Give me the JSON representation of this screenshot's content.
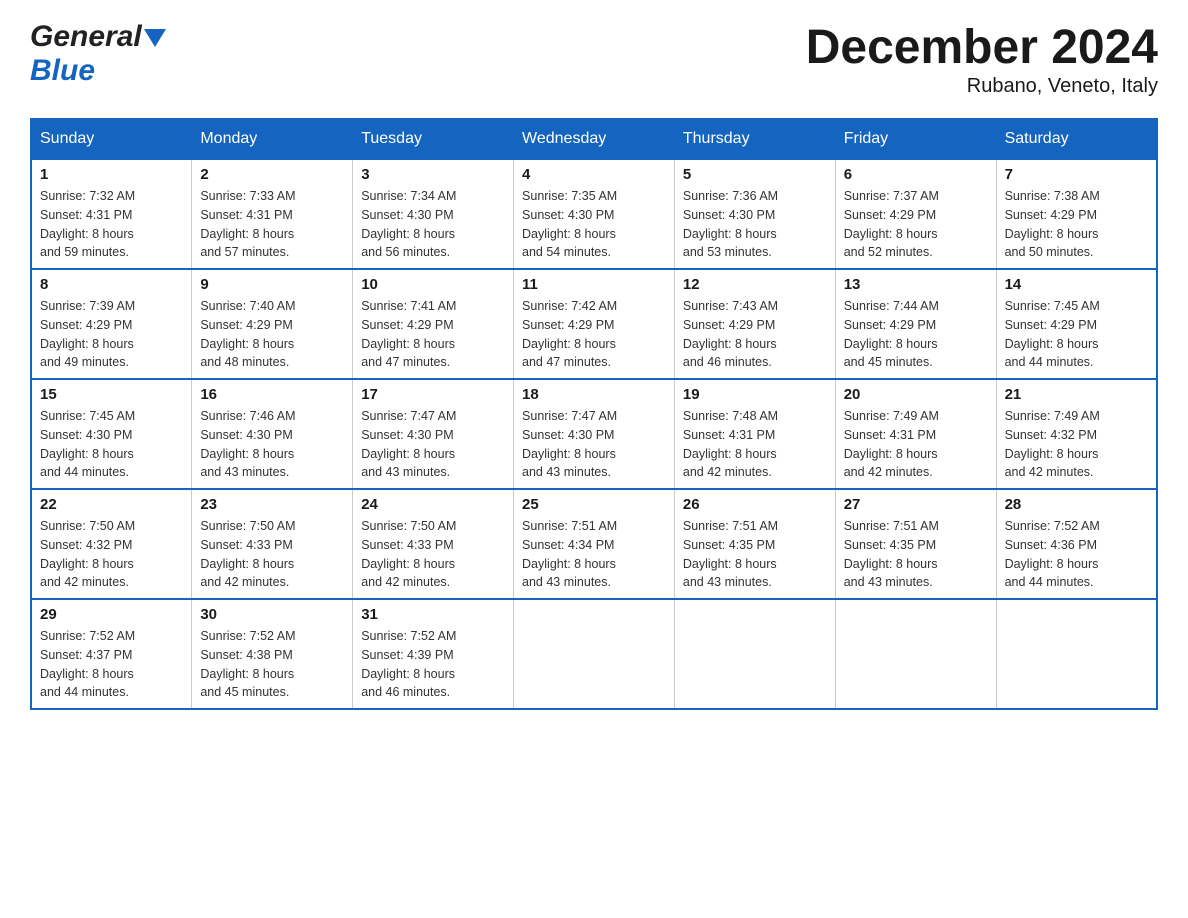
{
  "header": {
    "logo": {
      "general": "General",
      "blue": "Blue"
    },
    "title": "December 2024",
    "subtitle": "Rubano, Veneto, Italy"
  },
  "days_of_week": [
    "Sunday",
    "Monday",
    "Tuesday",
    "Wednesday",
    "Thursday",
    "Friday",
    "Saturday"
  ],
  "weeks": [
    [
      {
        "day": 1,
        "sunrise": "7:32 AM",
        "sunset": "4:31 PM",
        "daylight": "8 hours and 59 minutes."
      },
      {
        "day": 2,
        "sunrise": "7:33 AM",
        "sunset": "4:31 PM",
        "daylight": "8 hours and 57 minutes."
      },
      {
        "day": 3,
        "sunrise": "7:34 AM",
        "sunset": "4:30 PM",
        "daylight": "8 hours and 56 minutes."
      },
      {
        "day": 4,
        "sunrise": "7:35 AM",
        "sunset": "4:30 PM",
        "daylight": "8 hours and 54 minutes."
      },
      {
        "day": 5,
        "sunrise": "7:36 AM",
        "sunset": "4:30 PM",
        "daylight": "8 hours and 53 minutes."
      },
      {
        "day": 6,
        "sunrise": "7:37 AM",
        "sunset": "4:29 PM",
        "daylight": "8 hours and 52 minutes."
      },
      {
        "day": 7,
        "sunrise": "7:38 AM",
        "sunset": "4:29 PM",
        "daylight": "8 hours and 50 minutes."
      }
    ],
    [
      {
        "day": 8,
        "sunrise": "7:39 AM",
        "sunset": "4:29 PM",
        "daylight": "8 hours and 49 minutes."
      },
      {
        "day": 9,
        "sunrise": "7:40 AM",
        "sunset": "4:29 PM",
        "daylight": "8 hours and 48 minutes."
      },
      {
        "day": 10,
        "sunrise": "7:41 AM",
        "sunset": "4:29 PM",
        "daylight": "8 hours and 47 minutes."
      },
      {
        "day": 11,
        "sunrise": "7:42 AM",
        "sunset": "4:29 PM",
        "daylight": "8 hours and 47 minutes."
      },
      {
        "day": 12,
        "sunrise": "7:43 AM",
        "sunset": "4:29 PM",
        "daylight": "8 hours and 46 minutes."
      },
      {
        "day": 13,
        "sunrise": "7:44 AM",
        "sunset": "4:29 PM",
        "daylight": "8 hours and 45 minutes."
      },
      {
        "day": 14,
        "sunrise": "7:45 AM",
        "sunset": "4:29 PM",
        "daylight": "8 hours and 44 minutes."
      }
    ],
    [
      {
        "day": 15,
        "sunrise": "7:45 AM",
        "sunset": "4:30 PM",
        "daylight": "8 hours and 44 minutes."
      },
      {
        "day": 16,
        "sunrise": "7:46 AM",
        "sunset": "4:30 PM",
        "daylight": "8 hours and 43 minutes."
      },
      {
        "day": 17,
        "sunrise": "7:47 AM",
        "sunset": "4:30 PM",
        "daylight": "8 hours and 43 minutes."
      },
      {
        "day": 18,
        "sunrise": "7:47 AM",
        "sunset": "4:30 PM",
        "daylight": "8 hours and 43 minutes."
      },
      {
        "day": 19,
        "sunrise": "7:48 AM",
        "sunset": "4:31 PM",
        "daylight": "8 hours and 42 minutes."
      },
      {
        "day": 20,
        "sunrise": "7:49 AM",
        "sunset": "4:31 PM",
        "daylight": "8 hours and 42 minutes."
      },
      {
        "day": 21,
        "sunrise": "7:49 AM",
        "sunset": "4:32 PM",
        "daylight": "8 hours and 42 minutes."
      }
    ],
    [
      {
        "day": 22,
        "sunrise": "7:50 AM",
        "sunset": "4:32 PM",
        "daylight": "8 hours and 42 minutes."
      },
      {
        "day": 23,
        "sunrise": "7:50 AM",
        "sunset": "4:33 PM",
        "daylight": "8 hours and 42 minutes."
      },
      {
        "day": 24,
        "sunrise": "7:50 AM",
        "sunset": "4:33 PM",
        "daylight": "8 hours and 42 minutes."
      },
      {
        "day": 25,
        "sunrise": "7:51 AM",
        "sunset": "4:34 PM",
        "daylight": "8 hours and 43 minutes."
      },
      {
        "day": 26,
        "sunrise": "7:51 AM",
        "sunset": "4:35 PM",
        "daylight": "8 hours and 43 minutes."
      },
      {
        "day": 27,
        "sunrise": "7:51 AM",
        "sunset": "4:35 PM",
        "daylight": "8 hours and 43 minutes."
      },
      {
        "day": 28,
        "sunrise": "7:52 AM",
        "sunset": "4:36 PM",
        "daylight": "8 hours and 44 minutes."
      }
    ],
    [
      {
        "day": 29,
        "sunrise": "7:52 AM",
        "sunset": "4:37 PM",
        "daylight": "8 hours and 44 minutes."
      },
      {
        "day": 30,
        "sunrise": "7:52 AM",
        "sunset": "4:38 PM",
        "daylight": "8 hours and 45 minutes."
      },
      {
        "day": 31,
        "sunrise": "7:52 AM",
        "sunset": "4:39 PM",
        "daylight": "8 hours and 46 minutes."
      },
      null,
      null,
      null,
      null
    ]
  ],
  "labels": {
    "sunrise": "Sunrise:",
    "sunset": "Sunset:",
    "daylight": "Daylight:"
  },
  "colors": {
    "header_bg": "#1565c0",
    "border": "#1565c0"
  }
}
